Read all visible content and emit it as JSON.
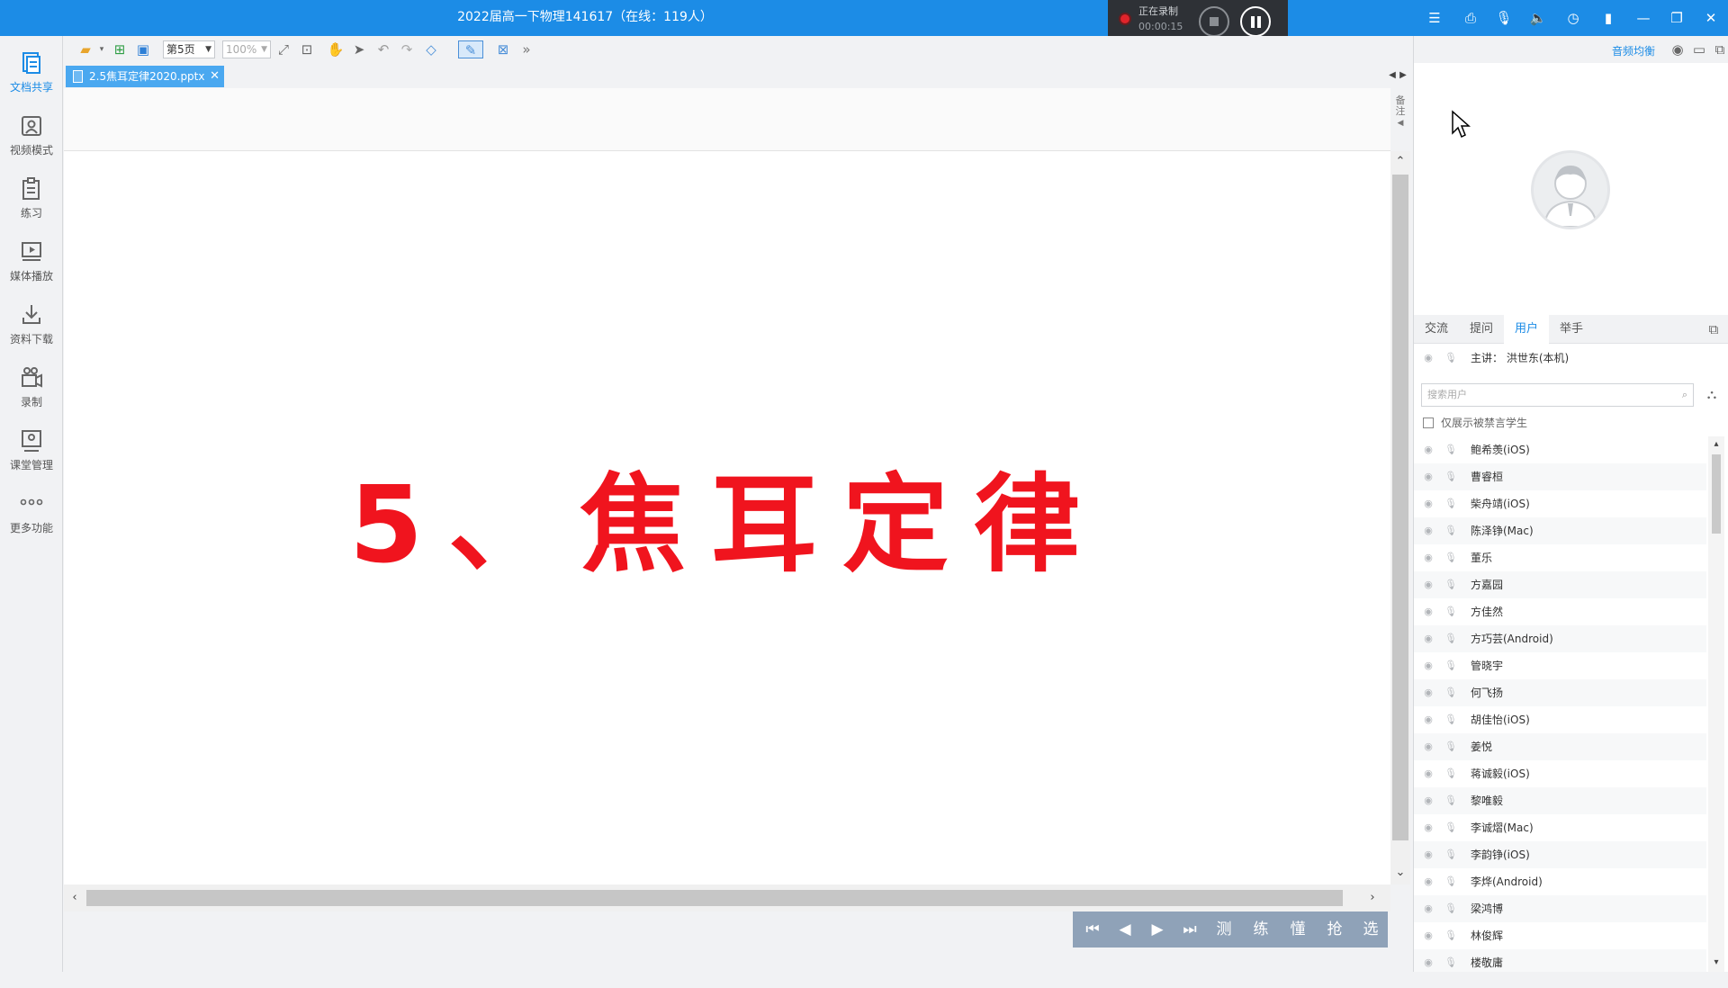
{
  "window": {
    "title": "2022届高一下物理141617（在线：119人）"
  },
  "recording": {
    "status_label": "正在录制",
    "elapsed": "00:00:15"
  },
  "sidebar": {
    "items": [
      {
        "label": "文档共享",
        "icon": "document-share-icon"
      },
      {
        "label": "视频模式",
        "icon": "video-mode-icon"
      },
      {
        "label": "练习",
        "icon": "exercise-icon"
      },
      {
        "label": "媒体播放",
        "icon": "media-play-icon"
      },
      {
        "label": "资料下载",
        "icon": "download-icon"
      },
      {
        "label": "录制",
        "icon": "record-icon"
      },
      {
        "label": "课堂管理",
        "icon": "class-manage-icon"
      },
      {
        "label": "更多功能",
        "icon": "more-icon"
      }
    ]
  },
  "toolbar": {
    "page_select": "第5页",
    "zoom_select": "100%"
  },
  "doc": {
    "tab_name": "2.5焦耳定律2020.pptx",
    "notes_label": "备注"
  },
  "slide": {
    "title": "5、焦耳定律",
    "title_color": "#f0141e"
  },
  "bottom_nav": {
    "test": "测",
    "practice": "练",
    "understand": "懂",
    "grab": "抢",
    "choose": "选"
  },
  "right_panel": {
    "audio_balance": "音频均衡",
    "tabs": [
      "交流",
      "提问",
      "用户",
      "举手"
    ],
    "active_tab": "用户",
    "host_line": "主讲：  洪世东(本机)",
    "search_placeholder": "搜索用户",
    "only_muted_label": "仅展示被禁言学生",
    "users": [
      "鲍希羡(iOS)",
      "曹睿桓",
      "柴舟靖(iOS)",
      "陈泽铮(Mac)",
      "董乐",
      "方嘉园",
      "方佳然",
      "方巧芸(Android)",
      "管晓宇",
      "何飞扬",
      "胡佳怡(iOS)",
      "姜悦",
      "蒋诚毅(iOS)",
      "黎唯毅",
      "李诚熠(Mac)",
      "李韵铮(iOS)",
      "李烨(Android)",
      "梁鸿博",
      "林俊辉",
      "楼敬庸"
    ]
  },
  "colors": {
    "titlebar": "#1c8ce6",
    "accent": "#1c8ce6",
    "nav_bar": "#8fa2b8"
  }
}
